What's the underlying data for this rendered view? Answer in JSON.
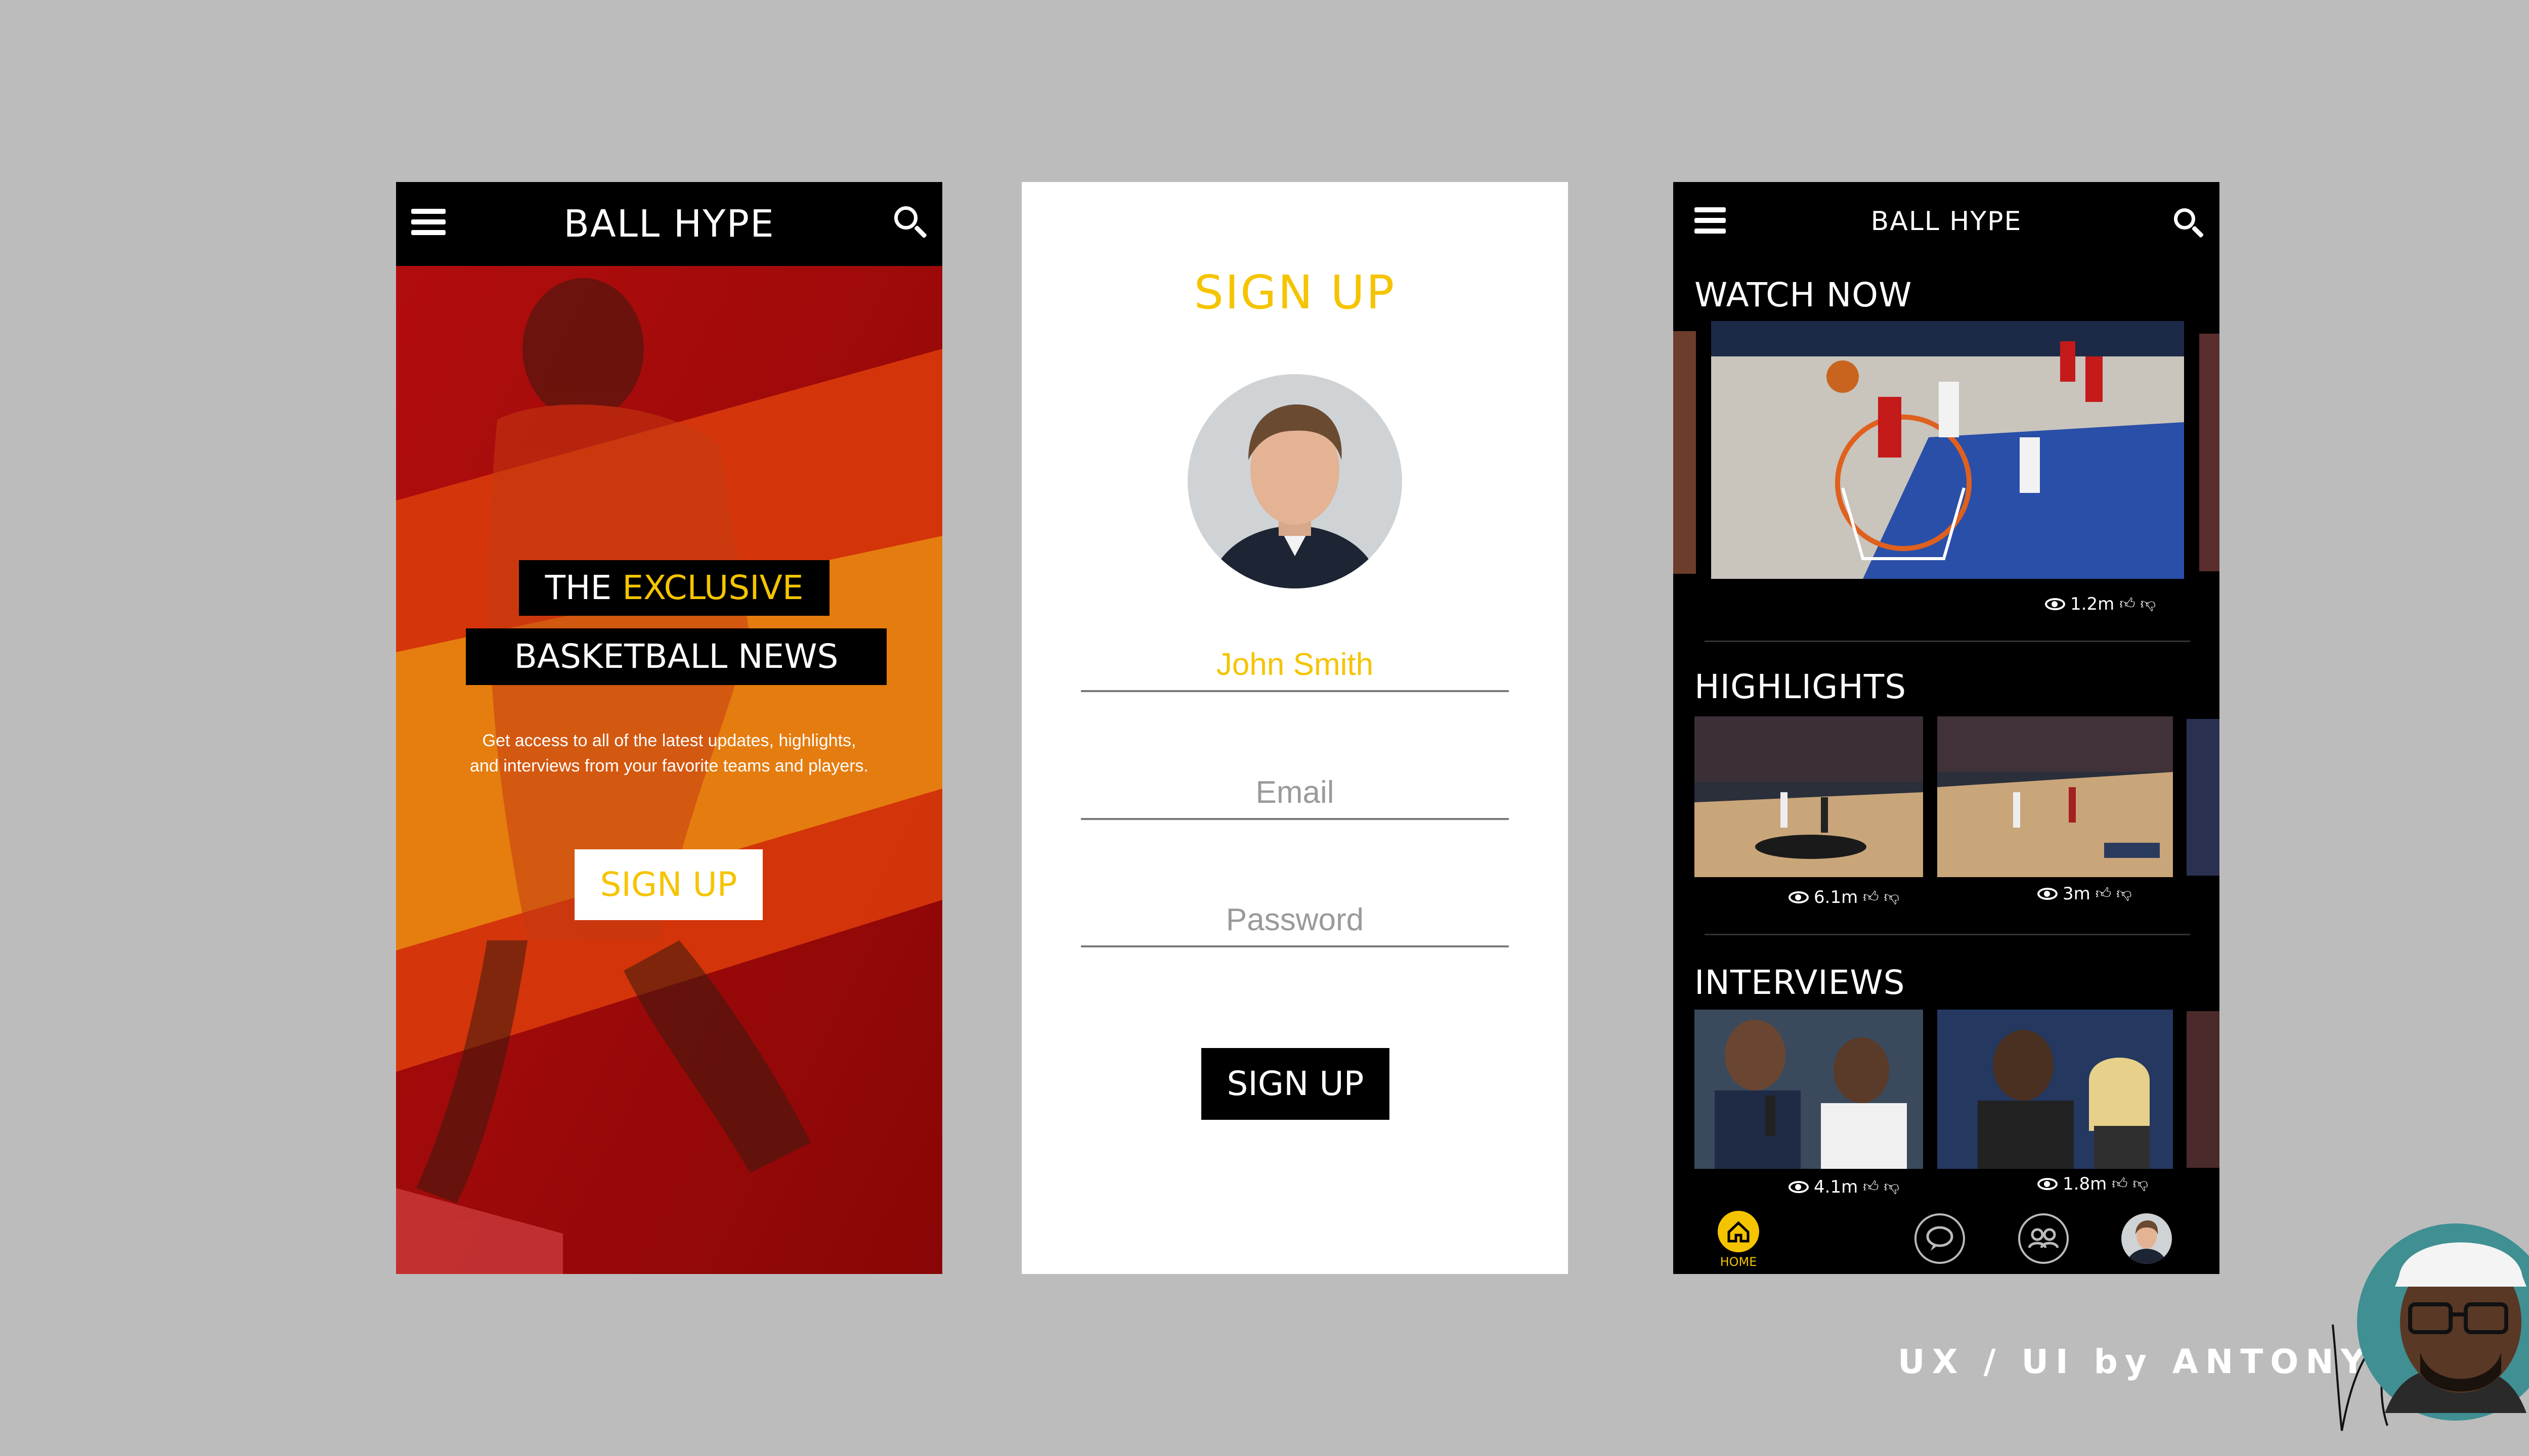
{
  "colors": {
    "accent": "#f5c400",
    "background": "#bcbcbc",
    "splash_red": "#a10a0a",
    "splash_orange": "#e87a0a"
  },
  "screen1": {
    "brand": "BALL HYPE",
    "headline_the": "THE",
    "headline_exclusive": "EXCLUSIVE",
    "headline_line2": "BASKETBALL NEWS",
    "body_line1": "Get access to all of the latest updates, highlights,",
    "body_line2": "and interviews from your favorite teams and players.",
    "signup_label": "SIGN UP",
    "icons": {
      "menu": "menu-icon",
      "search": "search-icon"
    }
  },
  "screen2": {
    "title": "SIGN UP",
    "name_value": "John Smith",
    "email_placeholder": "Email",
    "password_placeholder": "Password",
    "signup_label": "SIGN UP"
  },
  "screen3": {
    "brand": "BALL HYPE",
    "watch_now": {
      "title": "WATCH NOW",
      "views": "1.2m"
    },
    "highlights": {
      "title": "HIGHLIGHTS",
      "items": [
        {
          "views": "6.1m"
        },
        {
          "views": "3m"
        }
      ]
    },
    "interviews": {
      "title": "INTERVIEWS",
      "items": [
        {
          "views": "4.1m"
        },
        {
          "views": "1.8m"
        }
      ]
    },
    "nav": {
      "home_label": "HOME",
      "icons": [
        "home-icon",
        "chat-icon",
        "friends-icon",
        "profile-avatar"
      ]
    }
  },
  "credit": {
    "text": "UX / UI by ANTONY"
  }
}
